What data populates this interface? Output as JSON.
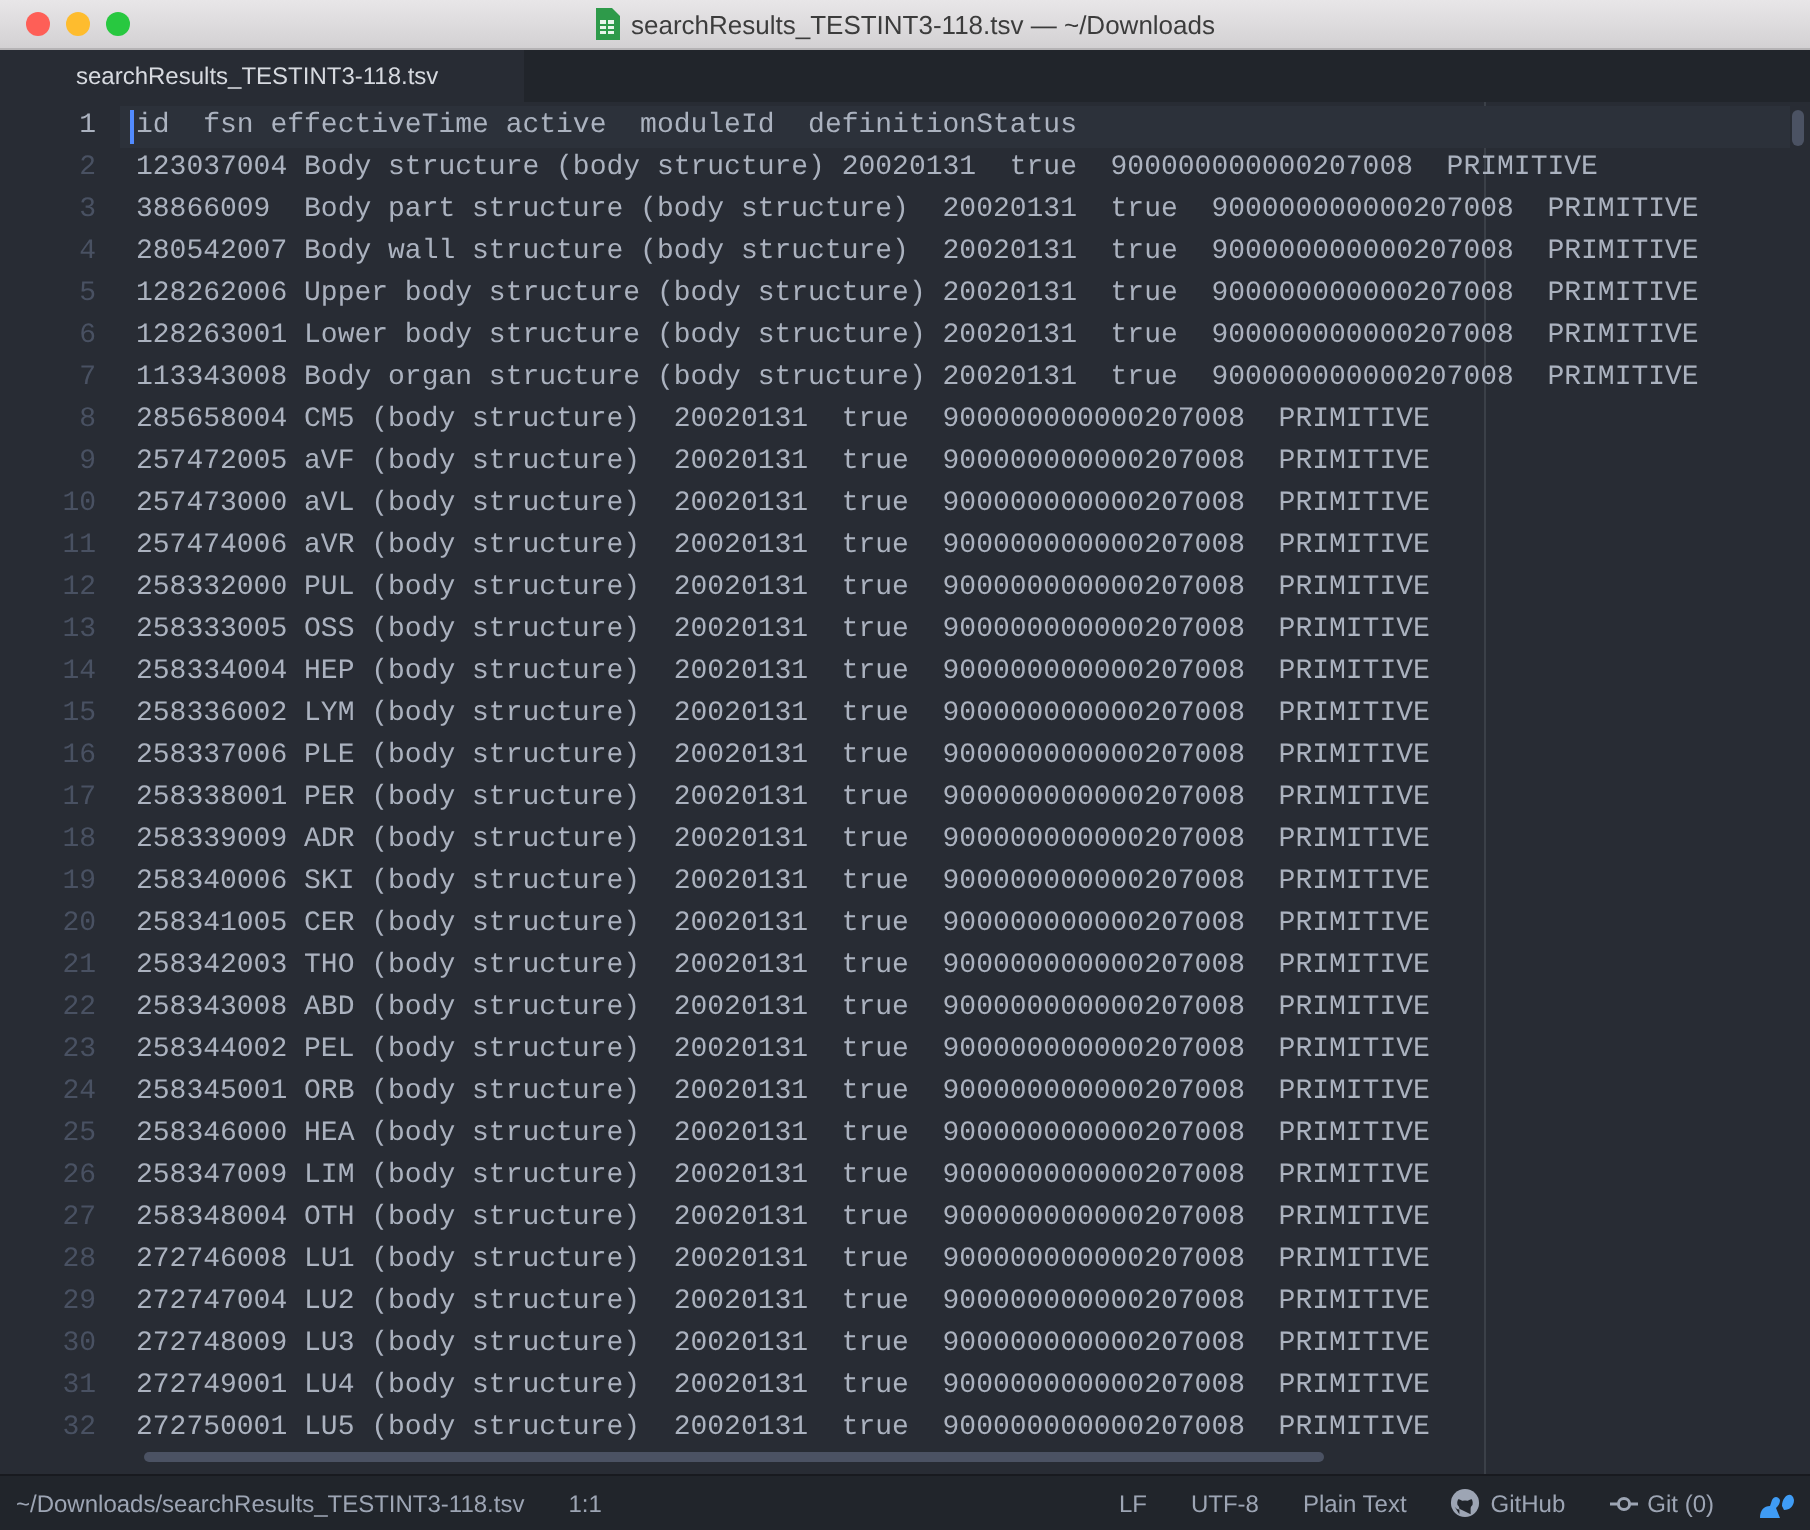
{
  "window": {
    "title": "searchResults_TESTINT3-118.tsv — ~/Downloads"
  },
  "tabs": [
    {
      "label": "searchResults_TESTINT3-118.tsv",
      "selected": true
    }
  ],
  "editor": {
    "lines": [
      {
        "number": "1",
        "text": "id  fsn effectiveTime active  moduleId  definitionStatus",
        "cursor": true
      },
      {
        "number": "2",
        "text": "123037004 Body structure (body structure) 20020131  true  900000000000207008  PRIMITIVE",
        "cursor": false
      },
      {
        "number": "3",
        "text": "38866009  Body part structure (body structure)  20020131  true  900000000000207008  PRIMITIVE",
        "cursor": false
      },
      {
        "number": "4",
        "text": "280542007 Body wall structure (body structure)  20020131  true  900000000000207008  PRIMITIVE",
        "cursor": false
      },
      {
        "number": "5",
        "text": "128262006 Upper body structure (body structure) 20020131  true  900000000000207008  PRIMITIVE",
        "cursor": false
      },
      {
        "number": "6",
        "text": "128263001 Lower body structure (body structure) 20020131  true  900000000000207008  PRIMITIVE",
        "cursor": false
      },
      {
        "number": "7",
        "text": "113343008 Body organ structure (body structure) 20020131  true  900000000000207008  PRIMITIVE",
        "cursor": false
      },
      {
        "number": "8",
        "text": "285658004 CM5 (body structure)  20020131  true  900000000000207008  PRIMITIVE",
        "cursor": false
      },
      {
        "number": "9",
        "text": "257472005 aVF (body structure)  20020131  true  900000000000207008  PRIMITIVE",
        "cursor": false
      },
      {
        "number": "10",
        "text": "257473000 aVL (body structure)  20020131  true  900000000000207008  PRIMITIVE",
        "cursor": false
      },
      {
        "number": "11",
        "text": "257474006 aVR (body structure)  20020131  true  900000000000207008  PRIMITIVE",
        "cursor": false
      },
      {
        "number": "12",
        "text": "258332000 PUL (body structure)  20020131  true  900000000000207008  PRIMITIVE",
        "cursor": false
      },
      {
        "number": "13",
        "text": "258333005 OSS (body structure)  20020131  true  900000000000207008  PRIMITIVE",
        "cursor": false
      },
      {
        "number": "14",
        "text": "258334004 HEP (body structure)  20020131  true  900000000000207008  PRIMITIVE",
        "cursor": false
      },
      {
        "number": "15",
        "text": "258336002 LYM (body structure)  20020131  true  900000000000207008  PRIMITIVE",
        "cursor": false
      },
      {
        "number": "16",
        "text": "258337006 PLE (body structure)  20020131  true  900000000000207008  PRIMITIVE",
        "cursor": false
      },
      {
        "number": "17",
        "text": "258338001 PER (body structure)  20020131  true  900000000000207008  PRIMITIVE",
        "cursor": false
      },
      {
        "number": "18",
        "text": "258339009 ADR (body structure)  20020131  true  900000000000207008  PRIMITIVE",
        "cursor": false
      },
      {
        "number": "19",
        "text": "258340006 SKI (body structure)  20020131  true  900000000000207008  PRIMITIVE",
        "cursor": false
      },
      {
        "number": "20",
        "text": "258341005 CER (body structure)  20020131  true  900000000000207008  PRIMITIVE",
        "cursor": false
      },
      {
        "number": "21",
        "text": "258342003 THO (body structure)  20020131  true  900000000000207008  PRIMITIVE",
        "cursor": false
      },
      {
        "number": "22",
        "text": "258343008 ABD (body structure)  20020131  true  900000000000207008  PRIMITIVE",
        "cursor": false
      },
      {
        "number": "23",
        "text": "258344002 PEL (body structure)  20020131  true  900000000000207008  PRIMITIVE",
        "cursor": false
      },
      {
        "number": "24",
        "text": "258345001 ORB (body structure)  20020131  true  900000000000207008  PRIMITIVE",
        "cursor": false
      },
      {
        "number": "25",
        "text": "258346000 HEA (body structure)  20020131  true  900000000000207008  PRIMITIVE",
        "cursor": false
      },
      {
        "number": "26",
        "text": "258347009 LIM (body structure)  20020131  true  900000000000207008  PRIMITIVE",
        "cursor": false
      },
      {
        "number": "27",
        "text": "258348004 OTH (body structure)  20020131  true  900000000000207008  PRIMITIVE",
        "cursor": false
      },
      {
        "number": "28",
        "text": "272746008 LU1 (body structure)  20020131  true  900000000000207008  PRIMITIVE",
        "cursor": false
      },
      {
        "number": "29",
        "text": "272747004 LU2 (body structure)  20020131  true  900000000000207008  PRIMITIVE",
        "cursor": false
      },
      {
        "number": "30",
        "text": "272748009 LU3 (body structure)  20020131  true  900000000000207008  PRIMITIVE",
        "cursor": false
      },
      {
        "number": "31",
        "text": "272749001 LU4 (body structure)  20020131  true  900000000000207008  PRIMITIVE",
        "cursor": false
      },
      {
        "number": "32",
        "text": "272750001 LU5 (body structure)  20020131  true  900000000000207008  PRIMITIVE",
        "cursor": false
      }
    ]
  },
  "status_bar": {
    "path": "~/Downloads/searchResults_TESTINT3-118.tsv",
    "position": "1:1",
    "line_ending": "LF",
    "encoding": "UTF-8",
    "grammar": "Plain Text",
    "github": "GitHub",
    "git": "Git (0)"
  }
}
